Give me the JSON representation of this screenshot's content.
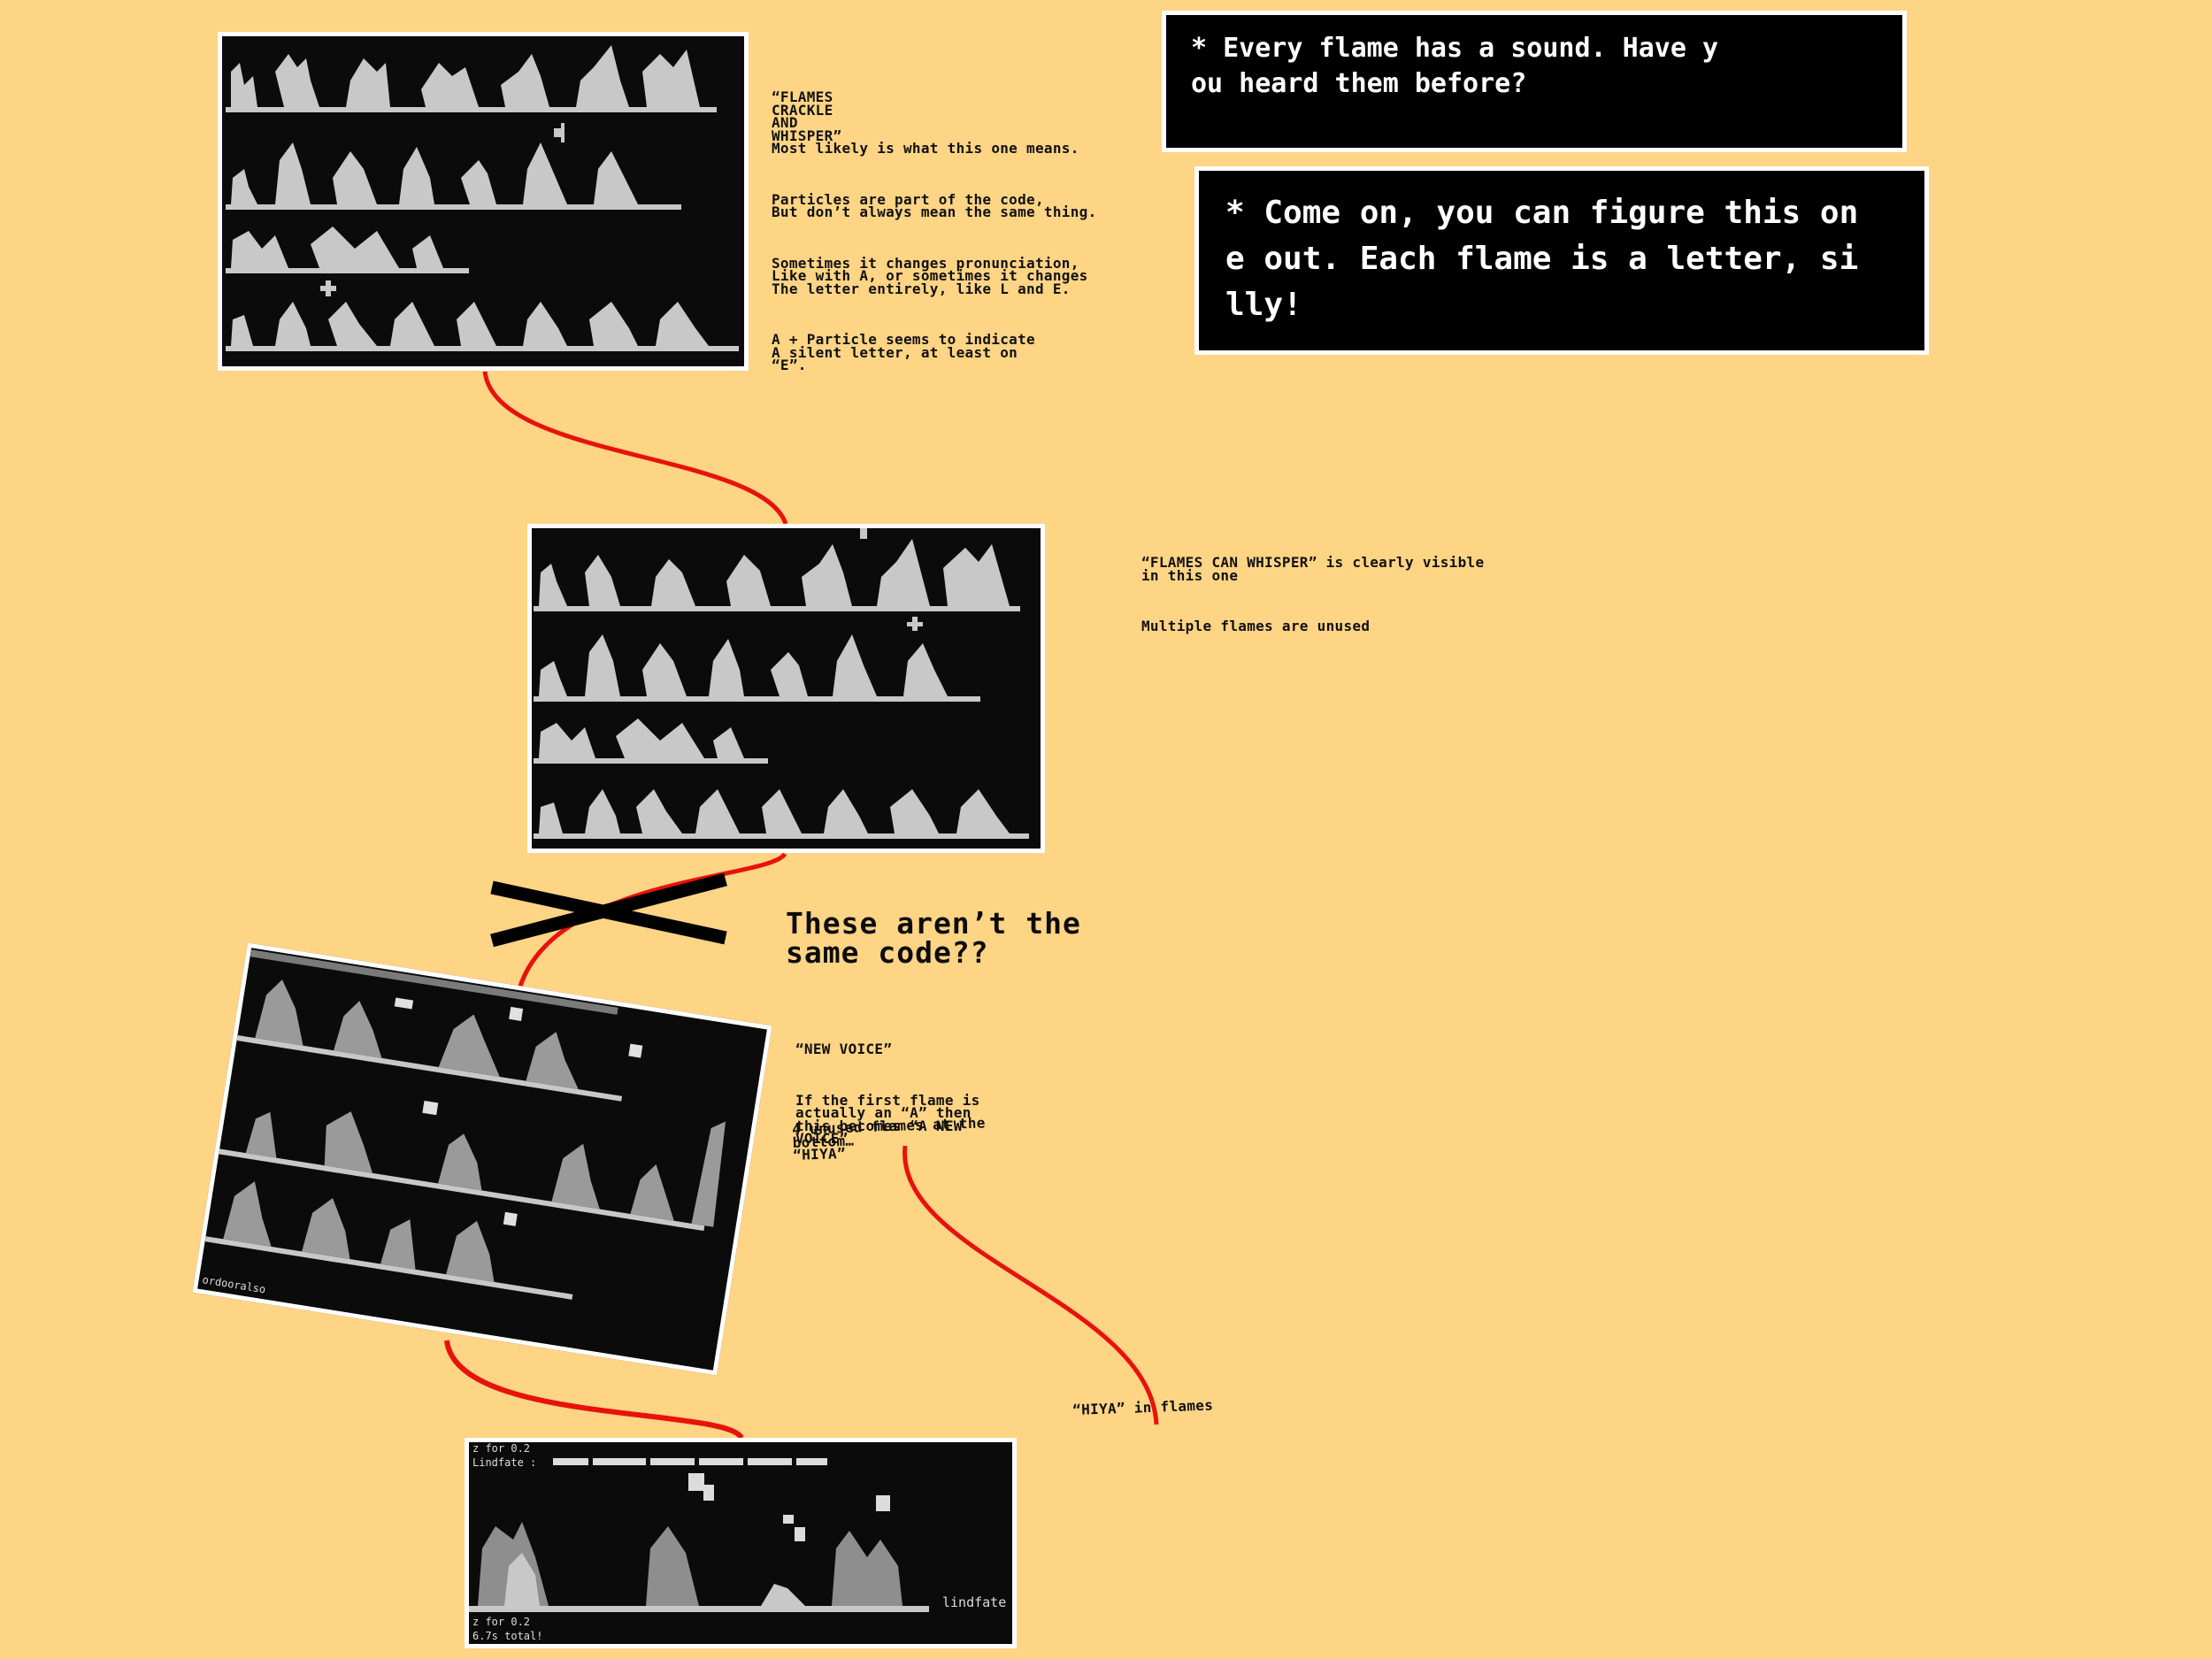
{
  "colors": {
    "background": "#fed485",
    "panel": "#0b0b0b",
    "flame": "#c8c8c8",
    "connector": "#e8120c",
    "text": "#111111"
  },
  "dialogs": {
    "top": "* Every flame has a sound. Have y\nou heard them before?",
    "bottom": "* Come on, you can figure this on\ne out. Each flame is a letter, si\nlly!"
  },
  "notes": {
    "panel1": {
      "p1": "“FLAMES\nCRACKLE\nAND\nWHISPER”\nMost likely is what this one means.",
      "p2": "Particles are part of the code,\nBut don’t always mean the same thing.",
      "p3": "Sometimes it changes pronunciation,\nLike with A, or sometimes it changes\nThe letter entirely, like L and E.",
      "p4": "A + Particle seems to indicate\nA silent letter, at least on\n“E”."
    },
    "panel2": {
      "p1": "“FLAMES CAN WHISPER” is clearly visible\nin this one",
      "p2": "Multiple flames are unused"
    },
    "question": "These aren’t the\nsame code??",
    "panel3": {
      "p1": "“NEW VOICE”",
      "p2": "If the first flame is\nactually an “A” then\nthis becomes “A NEW\nVOICE”",
      "p3": "4 unused flames at the\nbottom…\n“HIYA”"
    },
    "panel4": "“HIYA” in flames"
  },
  "panel3_caption": "ordooralso",
  "panel4_captions": {
    "top1": "z for 0.2",
    "top2": "Lindfate :",
    "right": "lindfate",
    "bottom1": "z for 0.2",
    "bottom2": "6.7s total!"
  }
}
